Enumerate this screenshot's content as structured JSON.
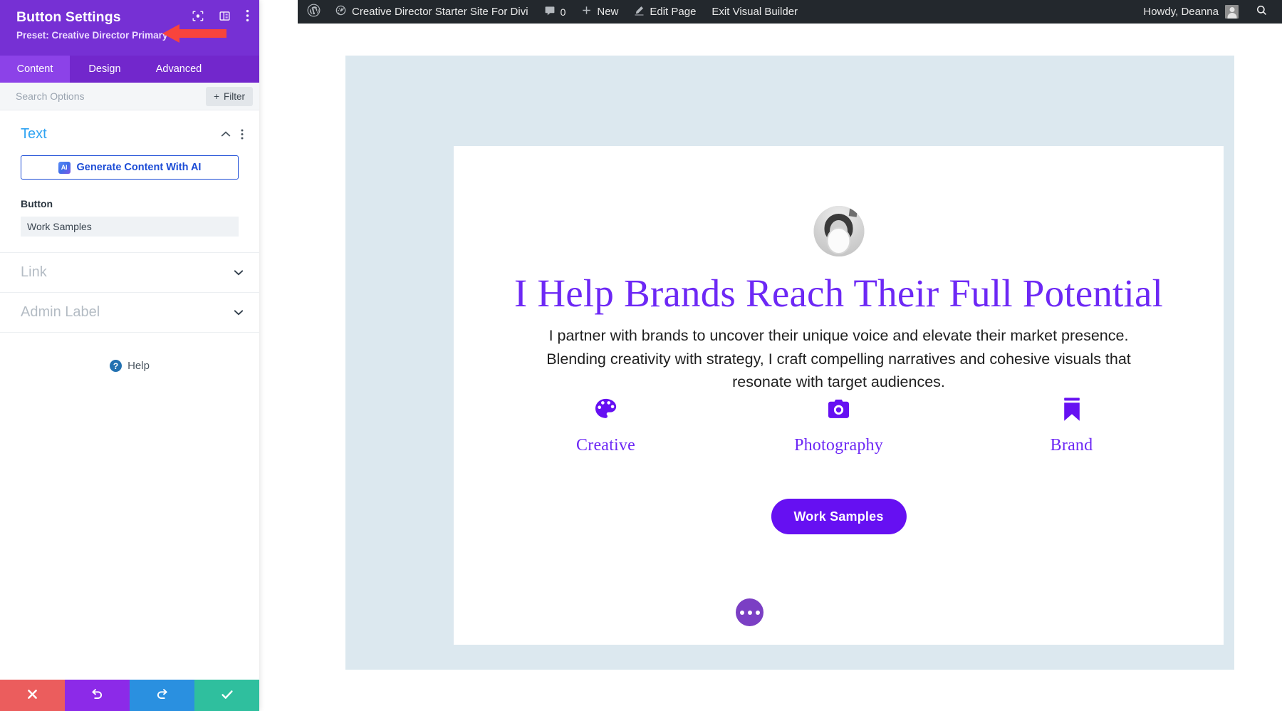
{
  "adminbar": {
    "logo_icon": "wordpress-logo-icon",
    "site_icon": "dashboard-icon",
    "site_name": "Creative Director Starter Site For Divi",
    "comments_icon": "comment-bubble-icon",
    "comments_count": "0",
    "new_icon": "plus-icon",
    "new_label": "New",
    "edit_icon": "pencil-icon",
    "edit_label": "Edit Page",
    "exit_label": "Exit Visual Builder",
    "howdy": "Howdy, Deanna",
    "avatar_icon": "user-avatar-icon",
    "search_icon": "search-icon"
  },
  "panel": {
    "title": "Button Settings",
    "preset_label": "Preset: Creative Director Primary",
    "preset_caret": "▾",
    "header_icons": [
      {
        "name": "focus-target-icon"
      },
      {
        "name": "panel-layout-icon"
      },
      {
        "name": "vertical-dots-icon"
      }
    ],
    "tabs": [
      {
        "label": "Content",
        "active": true
      },
      {
        "label": "Design",
        "active": false
      },
      {
        "label": "Advanced",
        "active": false
      }
    ],
    "search_placeholder": "Search Options",
    "search_value": "",
    "filter_label": "Filter",
    "filter_plus": "+",
    "sections": {
      "text": {
        "title": "Text",
        "collapse_icon": "chevron-up-icon",
        "menu_icon": "vertical-dots-icon",
        "ai_badge": "AI",
        "ai_label": "Generate Content With AI",
        "field_label": "Button",
        "field_value": "Work Samples"
      },
      "link": {
        "title": "Link",
        "expand_icon": "chevron-down-icon"
      },
      "admin_label": {
        "title": "Admin Label",
        "expand_icon": "chevron-down-icon"
      }
    },
    "help_label": "Help",
    "help_icon": "question-circle-icon",
    "actions": [
      {
        "name": "cancel-button",
        "icon": "x-icon",
        "color": "#eb5d5d"
      },
      {
        "name": "undo-button",
        "icon": "undo-icon",
        "color": "#8c2ae8"
      },
      {
        "name": "redo-button",
        "icon": "redo-icon",
        "color": "#2a90e0"
      },
      {
        "name": "save-button",
        "icon": "check-icon",
        "color": "#2fbf9e"
      }
    ],
    "annotation": {
      "name": "red-arrow-annotation",
      "color": "#f8443c"
    }
  },
  "page": {
    "heading": "I Help Brands Reach Their Full Potential",
    "paragraph": "I partner with brands to uncover their unique voice and elevate their market presence. Blending creativity with strategy, I craft compelling narratives and cohesive visuals that resonate with target audiences.",
    "avatar_alt": "portrait-photo",
    "features": [
      {
        "icon": "palette-icon",
        "label": "Creative"
      },
      {
        "icon": "camera-icon",
        "label": "Photography"
      },
      {
        "icon": "bookmark-icon",
        "label": "Brand"
      }
    ],
    "cta_label": "Work Samples",
    "fab_icon": "ellipsis-icon"
  },
  "colors": {
    "divi_purple": "#7630d4",
    "tab_purple": "#7227cc",
    "tab_active": "#8c42e8",
    "accent_blue": "#2ea3f2",
    "ai_blue": "#1c4cd6",
    "brand_purple": "#6d28f5",
    "cta_purple": "#6610f2",
    "section_blue": "#dce8ef",
    "adminbar_dark": "#23282d",
    "annotation_red": "#f8443c"
  }
}
